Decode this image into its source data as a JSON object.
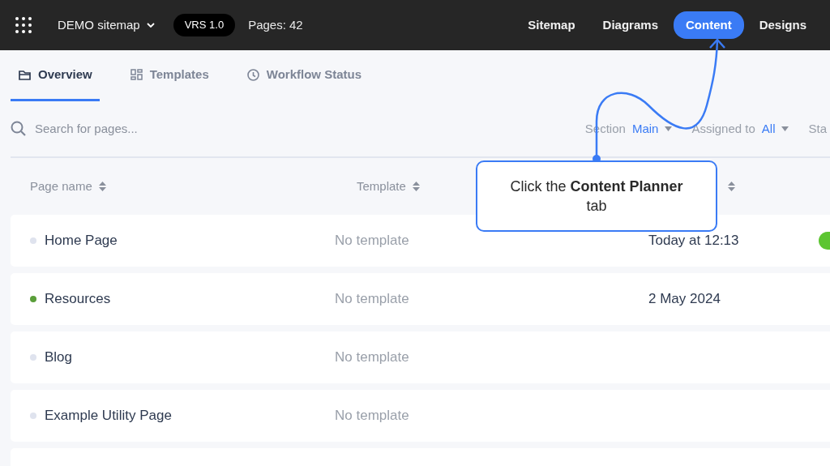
{
  "topbar": {
    "project": "DEMO sitemap",
    "version": "VRS 1.0",
    "pages": "Pages: 42",
    "nav": [
      {
        "label": "Sitemap",
        "selected": false
      },
      {
        "label": "Diagrams",
        "selected": false
      },
      {
        "label": "Content",
        "selected": true
      },
      {
        "label": "Designs",
        "selected": false
      }
    ]
  },
  "tabs": [
    {
      "label": "Overview",
      "selected": true
    },
    {
      "label": "Templates",
      "selected": false
    },
    {
      "label": "Workflow Status",
      "selected": false
    }
  ],
  "search": {
    "placeholder": "Search for pages..."
  },
  "filters": [
    {
      "label": "Section",
      "value": "Main"
    },
    {
      "label": "Assigned to",
      "value": "All"
    },
    {
      "label": "Sta"
    }
  ],
  "table": {
    "columns": [
      {
        "label": "Page name"
      },
      {
        "label": "Template"
      },
      {}
    ],
    "rows": [
      {
        "name": "Home Page",
        "color": "#dfe3ee",
        "template": "No template",
        "date": "Today at 12:13",
        "status_icon": {
          "color": "#5cc531"
        }
      },
      {
        "name": "Resources",
        "color": "#5a9e3a",
        "template": "No template",
        "date": "2 May 2024"
      },
      {
        "name": "Blog",
        "color": "#dfe3ee",
        "template": "No template"
      },
      {
        "name": "Example Utility Page",
        "color": "#dfe3ee",
        "template": "No template"
      },
      {}
    ]
  },
  "callout": {
    "text": "Click the **Content Planner** tab"
  }
}
